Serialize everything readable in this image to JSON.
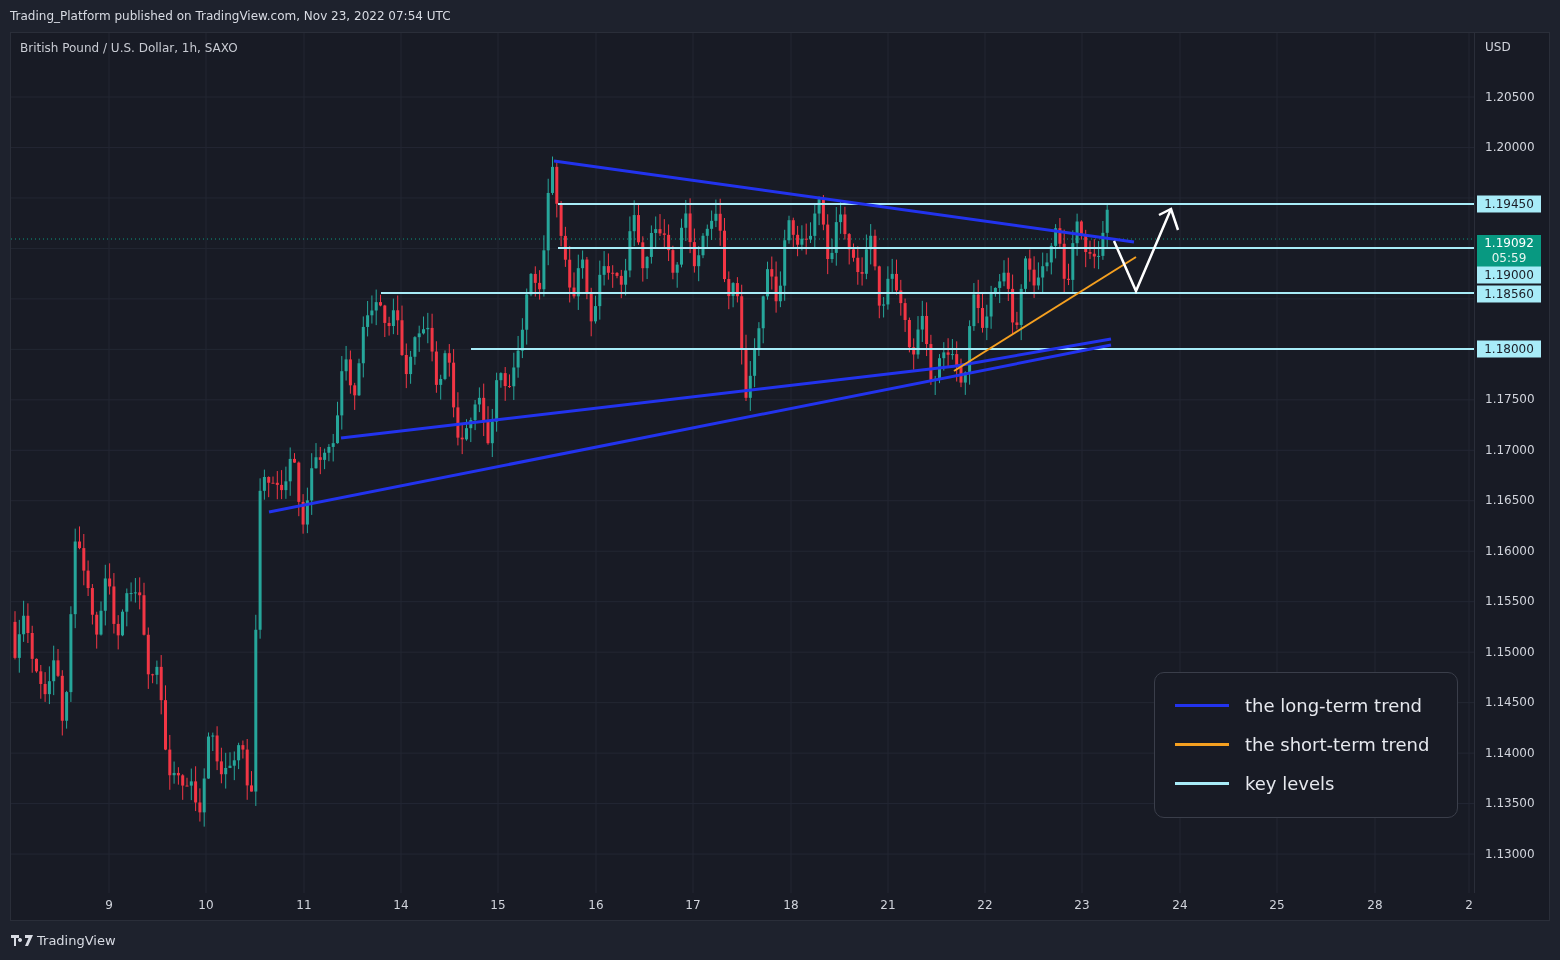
{
  "header": {
    "title": "Trading_Platform published on TradingView.com, Nov 23, 2022 07:54 UTC"
  },
  "chart": {
    "symbol": "British Pound / U.S. Dollar, 1h, SAXO",
    "currency": "USD",
    "y_axis": [
      "1.20500",
      "1.20000",
      "1.17500",
      "1.17000",
      "1.16500",
      "1.16000",
      "1.15500",
      "1.15000",
      "1.14500",
      "1.14000",
      "1.13500",
      "1.13000"
    ],
    "x_axis": [
      "9",
      "10",
      "11",
      "14",
      "15",
      "16",
      "17",
      "18",
      "21",
      "22",
      "23",
      "24",
      "25",
      "28",
      "2"
    ],
    "price_tags": [
      {
        "kind": "level",
        "label": "1.19450"
      },
      {
        "kind": "current",
        "label": "1.19092",
        "countdown": "05:59"
      },
      {
        "kind": "level",
        "label": "1.19000"
      },
      {
        "kind": "level",
        "label": "1.18560"
      },
      {
        "kind": "level",
        "label": "1.18000"
      }
    ],
    "legend": [
      {
        "label": "the long-term trend",
        "color": "#2233ee"
      },
      {
        "label": "the short-term trend",
        "color": "#f5a020"
      },
      {
        "label": "key levels",
        "color": "#a8ecf8"
      }
    ]
  },
  "footer": {
    "brand": "TradingView"
  }
}
